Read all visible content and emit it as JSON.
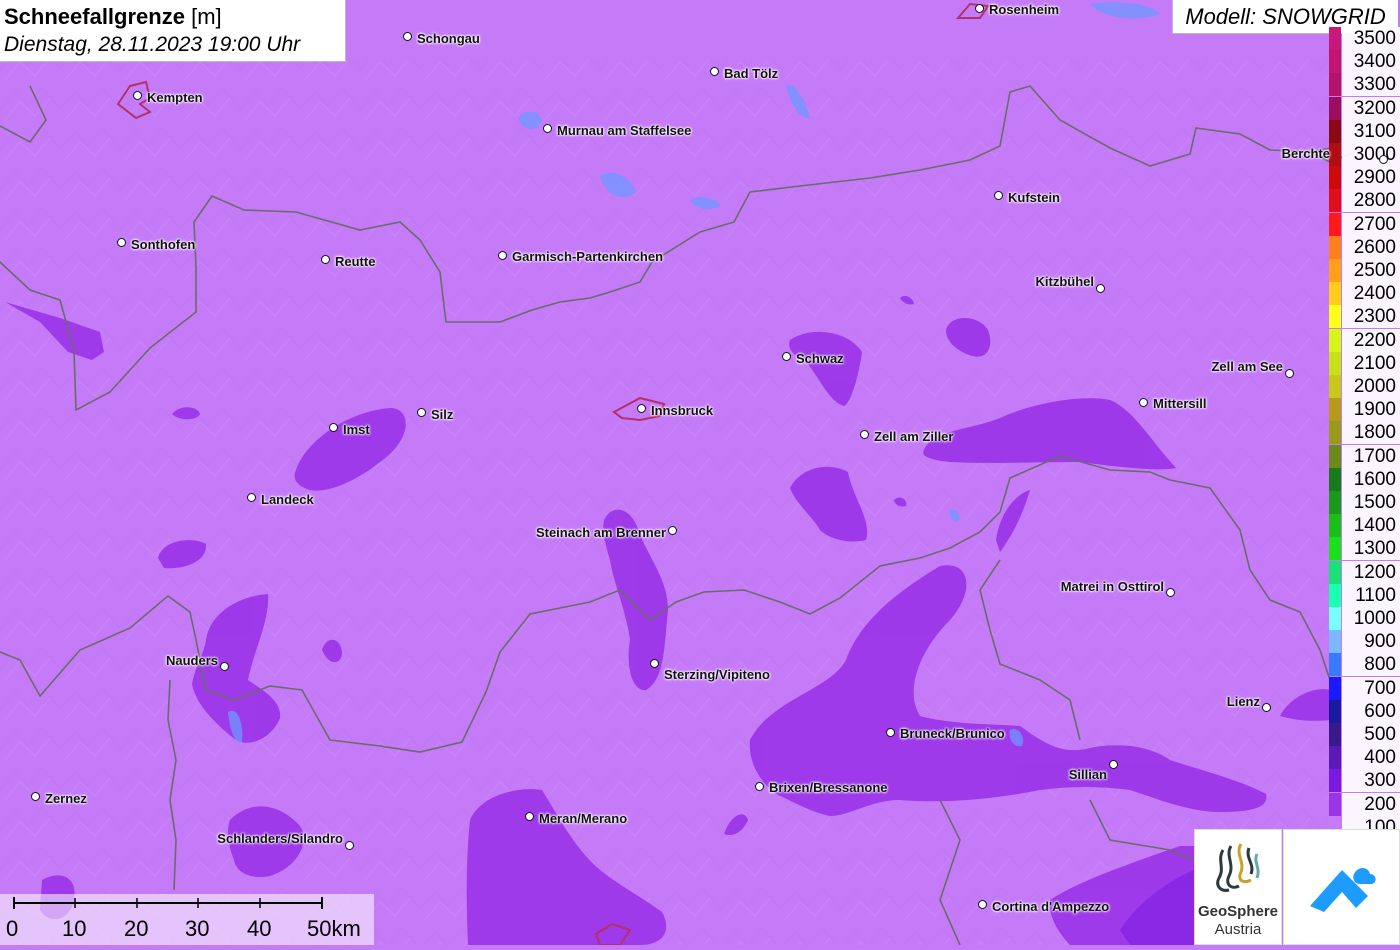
{
  "title": {
    "parameter": "Schneefallgrenze",
    "unit": "[m]",
    "datetime": "Dienstag, 28.11.2023 19:00 Uhr"
  },
  "model": "Modell: SNOWGRID",
  "colors": {
    "map_background": "#c57bf7",
    "zone_dark": "#9a34e8",
    "border": "#6b6b6b",
    "city_outline": "#b3306a",
    "lake": "#6e98ff"
  },
  "legend": {
    "unit": "m",
    "items": [
      {
        "label": "3500",
        "color": "#c8197a"
      },
      {
        "label": "3400",
        "color": "#c21572"
      },
      {
        "label": "3300",
        "color": "#b3136a"
      },
      {
        "label": "3200",
        "color": "#9b0f5e"
      },
      {
        "label": "3100",
        "color": "#8b0a12"
      },
      {
        "label": "3000",
        "color": "#b20d10"
      },
      {
        "label": "2900",
        "color": "#cc0a0a"
      },
      {
        "label": "2800",
        "color": "#e0101a"
      },
      {
        "label": "2700",
        "color": "#ff1a1a"
      },
      {
        "label": "2600",
        "color": "#ff7f1a"
      },
      {
        "label": "2500",
        "color": "#ff9f1a"
      },
      {
        "label": "2400",
        "color": "#ffcc1a"
      },
      {
        "label": "2300",
        "color": "#ffff1a"
      },
      {
        "label": "2200",
        "color": "#d8f51a"
      },
      {
        "label": "2100",
        "color": "#c8e01a"
      },
      {
        "label": "2000",
        "color": "#c8c81a"
      },
      {
        "label": "1900",
        "color": "#b89a1a"
      },
      {
        "label": "1800",
        "color": "#9a9a1a"
      },
      {
        "label": "1700",
        "color": "#6a8a1a"
      },
      {
        "label": "1600",
        "color": "#1a7a1a"
      },
      {
        "label": "1500",
        "color": "#1a9a1a"
      },
      {
        "label": "1400",
        "color": "#1abf1a"
      },
      {
        "label": "1300",
        "color": "#1ae01a"
      },
      {
        "label": "1200",
        "color": "#1ae07a"
      },
      {
        "label": "1100",
        "color": "#1affb0"
      },
      {
        "label": "1000",
        "color": "#7affff"
      },
      {
        "label": "900",
        "color": "#7ab8ff"
      },
      {
        "label": "800",
        "color": "#3a7aff"
      },
      {
        "label": "700",
        "color": "#1a1aff"
      },
      {
        "label": "600",
        "color": "#1a1aa0"
      },
      {
        "label": "500",
        "color": "#3a1a8a"
      },
      {
        "label": "400",
        "color": "#5a1ab8"
      },
      {
        "label": "300",
        "color": "#7a1ae0"
      },
      {
        "label": "200",
        "color": "#9a34e8"
      },
      {
        "label": "100",
        "color": "#c57bf7"
      }
    ]
  },
  "cities": [
    {
      "name": "Rosenheim"
    },
    {
      "name": "Schongau"
    },
    {
      "name": "Bad Tölz"
    },
    {
      "name": "Kempten"
    },
    {
      "name": "Murnau am Staffelsee"
    },
    {
      "name": "Berchte"
    },
    {
      "name": "Kufstein"
    },
    {
      "name": "Sonthofen"
    },
    {
      "name": "Reutte"
    },
    {
      "name": "Garmisch-Partenkirchen"
    },
    {
      "name": "Kitzbühel"
    },
    {
      "name": "Schwaz"
    },
    {
      "name": "Zell am See"
    },
    {
      "name": "Mittersill"
    },
    {
      "name": "Innsbruck"
    },
    {
      "name": "Silz"
    },
    {
      "name": "Imst"
    },
    {
      "name": "Zell am Ziller"
    },
    {
      "name": "Landeck"
    },
    {
      "name": "Steinach am Brenner"
    },
    {
      "name": "Matrei in Osttirol"
    },
    {
      "name": "Nauders"
    },
    {
      "name": "Sterzing/Vipiteno"
    },
    {
      "name": "Lienz"
    },
    {
      "name": "Bruneck/Brunico"
    },
    {
      "name": "Sillian"
    },
    {
      "name": "Brixen/Bressanone"
    },
    {
      "name": "Zernez"
    },
    {
      "name": "Meran/Merano"
    },
    {
      "name": "Schlanders/Silandro"
    },
    {
      "name": "Cortina d'Ampezzo"
    }
  ],
  "scale": {
    "ticks": [
      "0",
      "10",
      "20",
      "30",
      "40",
      "50km"
    ]
  },
  "logos": {
    "geosphere": {
      "line1": "GeoSphere",
      "line2": "Austria"
    }
  }
}
